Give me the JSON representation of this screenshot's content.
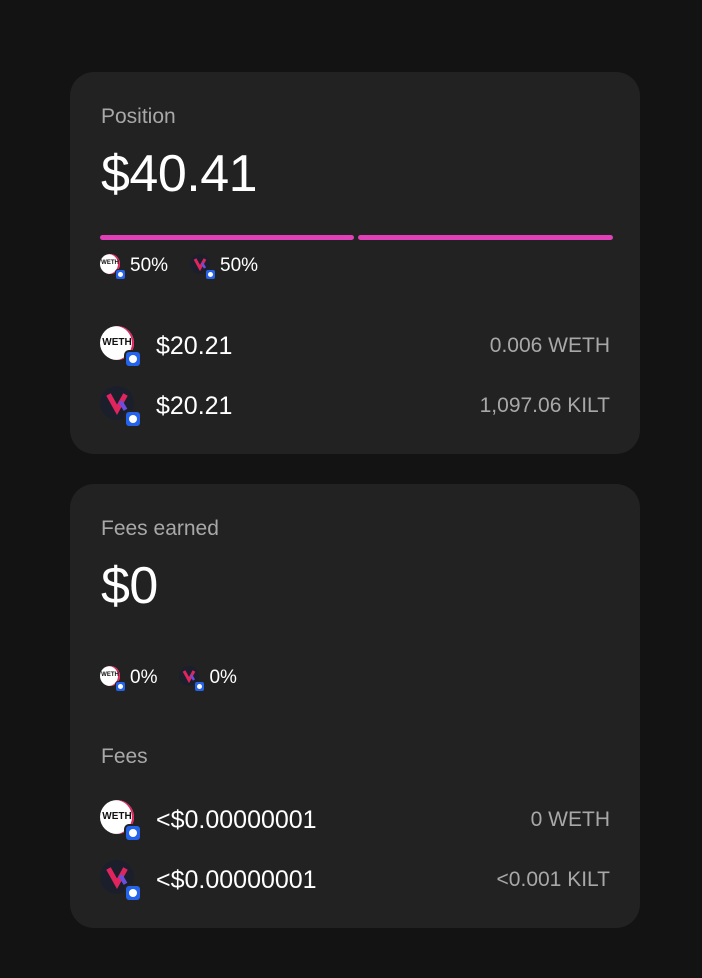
{
  "position": {
    "title": "Position",
    "value": "$40.41",
    "split": [
      {
        "token": "WETH",
        "pct": "50%",
        "icon": "weth-icon"
      },
      {
        "token": "KILT",
        "pct": "50%",
        "icon": "kilt-icon"
      }
    ],
    "rows": [
      {
        "token": "WETH",
        "icon_text": "WETH",
        "usd": "$20.21",
        "amount": "0.006 WETH"
      },
      {
        "token": "KILT",
        "usd": "$20.21",
        "amount": "1,097.06 KILT"
      }
    ],
    "bar_color": "#e040b8"
  },
  "fees_earned": {
    "title": "Fees earned",
    "value": "$0",
    "split": [
      {
        "token": "WETH",
        "pct": "0%"
      },
      {
        "token": "KILT",
        "pct": "0%"
      }
    ],
    "fees_label": "Fees",
    "rows": [
      {
        "token": "WETH",
        "usd": "<$0.00000001",
        "amount": "0 WETH"
      },
      {
        "token": "KILT",
        "usd": "<$0.00000001",
        "amount": "<0.001 KILT"
      }
    ]
  },
  "icon_text": {
    "weth": "WETH"
  },
  "colors": {
    "background": "#131313",
    "card": "#222222",
    "muted_text": "#a8a8a8",
    "network_badge": "#2563eb"
  }
}
